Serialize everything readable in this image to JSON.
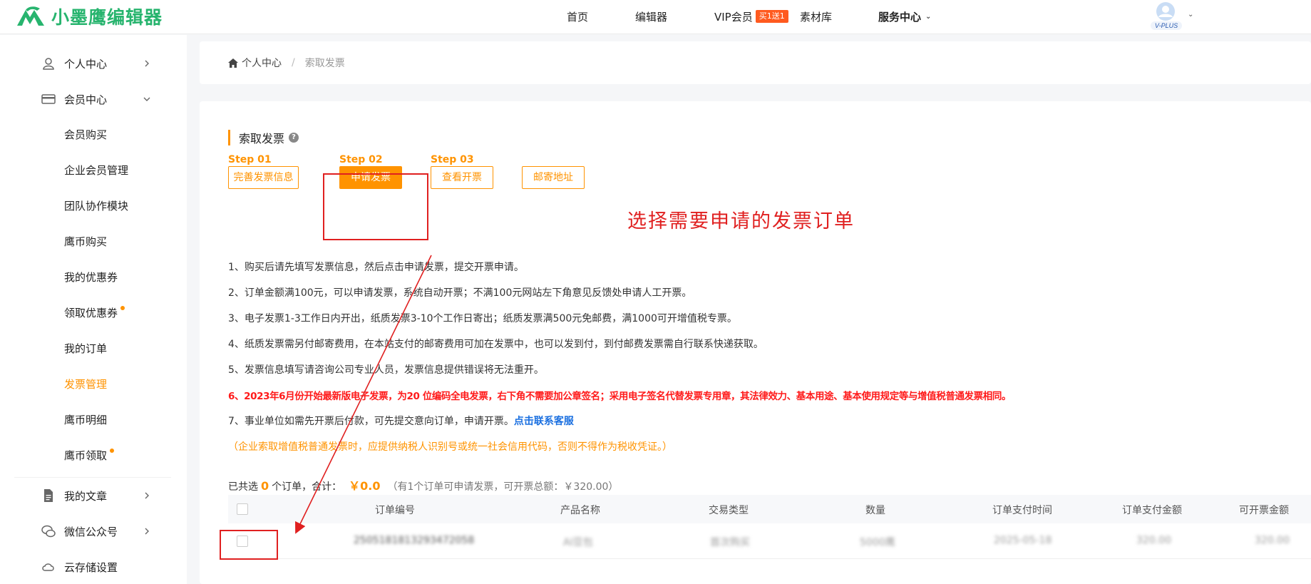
{
  "brand": {
    "name": "小墨鹰编辑器",
    "color": "#27b46e"
  },
  "nav": {
    "home": "首页",
    "editor": "编辑器",
    "vip": "VIP会员",
    "vip_badge": "买1送1",
    "materials": "素材库",
    "service": "服务中心"
  },
  "avatar": {
    "label": "V-PLUS"
  },
  "sidebar": {
    "personal": "个人中心",
    "member": "会员中心",
    "sub": [
      "会员购买",
      "企业会员管理",
      "团队协作模块",
      "鹰币购买",
      "我的优惠券",
      "领取优惠券",
      "我的订单",
      "发票管理",
      "鹰币明细",
      "鹰币领取"
    ],
    "articles": "我的文章",
    "wechat": "微信公众号",
    "cloud": "云存储设置"
  },
  "breadcrumb": {
    "home": "个人中心",
    "sep": "/",
    "current": "索取发票"
  },
  "section_title": "索取发票",
  "steps": [
    {
      "label": "Step 01",
      "button": "完善发票信息"
    },
    {
      "label": "Step 02",
      "button": "申请发票"
    },
    {
      "label": "Step 03",
      "button": "查看开票"
    },
    {
      "label": "",
      "button": "邮寄地址"
    }
  ],
  "annotation": "选择需要申请的发票订单",
  "notes": [
    "1、购买后请先填写发票信息，然后点击申请发票，提交开票申请。",
    "2、订单金额满100元，可以申请发票，系统自动开票；不满100元网站左下角意见反馈处申请人工开票。",
    "3、电子发票1-3工作日内开出，纸质发票3-10个工作日寄出；纸质发票满500元免邮费，满1000可开增值税专票。",
    "4、纸质发票需另付邮寄费用，在本站支付的邮寄费用可加在发票中，也可以发到付，到付邮费发票需自行联系快递获取。",
    "5、发票信息填写请咨询公司专业人员，发票信息提供错误将无法重开。",
    "6、2023年6月份开始最新版电子发票，为20 位编码全电发票，右下角不需要加公章签名；采用电子签名代替发票专用章，其法律效力、基本用途、基本使用规定等与增值税普通发票相同。",
    "7、事业单位如需先开票后付款，可先提交意向订单，申请开票。",
    "（企业索取增值税普通发票时，应提供纳税人识别号或统一社会信用代码，否则不得作为税收凭证。）"
  ],
  "contact_link": "点击联系客服",
  "summary": {
    "prefix": "已共选",
    "count": "0",
    "mid": "个订单，合计：",
    "amount": "￥0.0",
    "extra": "（有1个订单可申请发票，可开票总额：￥320.00）"
  },
  "table": {
    "headers": [
      "订单编号",
      "产品名称",
      "交易类型",
      "数量",
      "订单支付时间",
      "订单支付金额",
      "可开票金额"
    ],
    "row": [
      "2505181813293472058",
      "AI豆包",
      "首次购买",
      "5000鹰",
      "2025-05-18",
      "320.00",
      "320.00"
    ]
  },
  "colors": {
    "accent": "#ff9300",
    "annotation": "#e02020",
    "link": "#1a6fe0"
  }
}
